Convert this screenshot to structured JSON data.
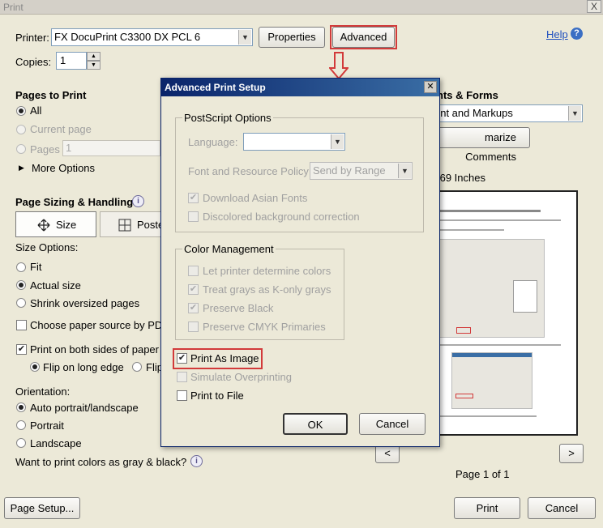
{
  "window": {
    "title": "Print",
    "close": "X"
  },
  "printer": {
    "label": "Printer:",
    "selected": "FX DocuPrint C3300 DX PCL 6",
    "properties_label": "Properties",
    "advanced_label": "Advanced"
  },
  "help": {
    "label": "Help"
  },
  "copies": {
    "label": "Copies:",
    "value": "1"
  },
  "pages_to_print": {
    "heading": "Pages to Print",
    "all": "All",
    "current_page": "Current page",
    "pages": "Pages",
    "pages_value": "1",
    "more_options": "More Options"
  },
  "comments": {
    "heading": "nts & Forms",
    "selected": "ent and Markups",
    "summarize_label": "marize Comments"
  },
  "page_size_text": ".69 Inches",
  "page_sizing": {
    "heading": "Page Sizing & Handling",
    "size_tab": "Size",
    "poster_tab": "Poste",
    "size_options_label": "Size Options:",
    "fit": "Fit",
    "actual_size": "Actual size",
    "shrink": "Shrink oversized pages",
    "paper_source": "Choose paper source by PDF p",
    "both_sides": "Print on both sides of paper",
    "flip_long": "Flip on long edge",
    "flip_short": "Flip"
  },
  "orientation": {
    "label": "Orientation:",
    "auto": "Auto portrait/landscape",
    "portrait": "Portrait",
    "landscape": "Landscape"
  },
  "gray_question": "Want to print colors as gray & black?",
  "page_nav": {
    "prev": "<",
    "next": ">",
    "page_label": "Page 1 of 1"
  },
  "footer": {
    "page_setup": "Page Setup...",
    "print": "Print",
    "cancel": "Cancel"
  },
  "advanced_dialog": {
    "title": "Advanced Print Setup",
    "postscript": {
      "legend": "PostScript Options",
      "language_label": "Language:",
      "language_value": "",
      "font_policy_label": "Font and Resource Policy:",
      "font_policy_value": "Send by Range",
      "download_asian": "Download Asian Fonts",
      "discolored_bg": "Discolored background correction"
    },
    "color_mgmt": {
      "legend": "Color Management",
      "let_printer": "Let printer determine colors",
      "treat_grays": "Treat grays as K-only grays",
      "preserve_black": "Preserve Black",
      "preserve_cmyk": "Preserve CMYK Primaries"
    },
    "print_as_image": "Print As Image",
    "simulate_overprinting": "Simulate Overprinting",
    "print_to_file": "Print to File",
    "ok": "OK",
    "cancel": "Cancel"
  },
  "colors": {
    "highlight_red": "#d23a3a",
    "title_blue": "#0a246a",
    "help_blue": "#1e4fbf"
  }
}
